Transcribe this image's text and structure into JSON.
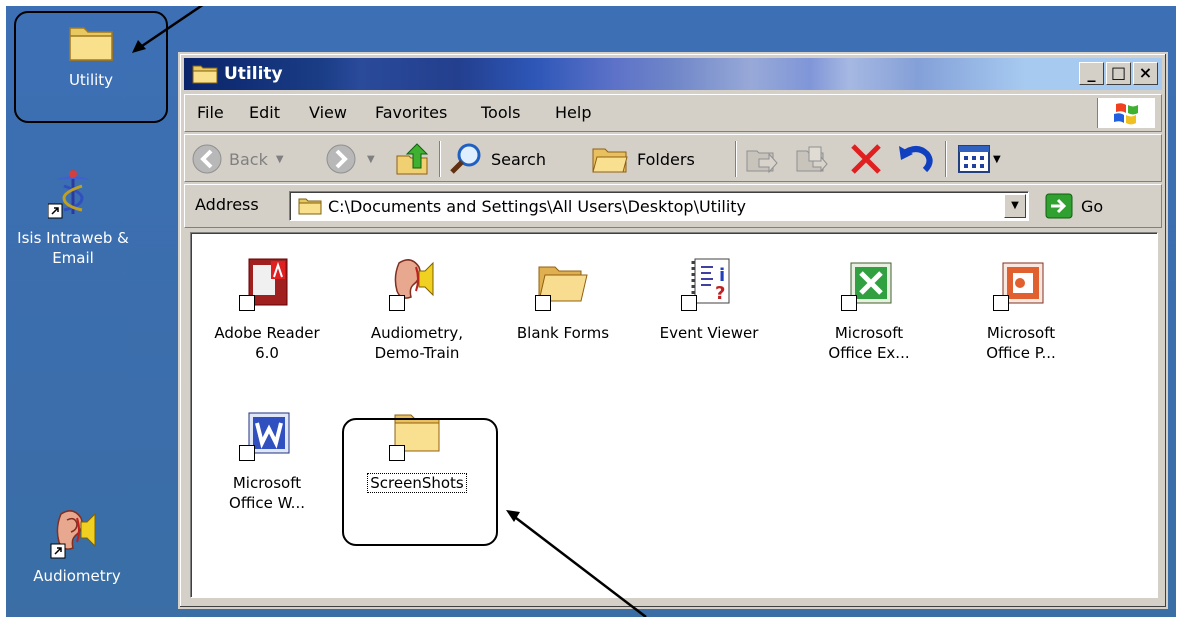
{
  "desktop": {
    "icons": [
      {
        "label": "Utility",
        "icon": "folder-icon"
      },
      {
        "label": "Isis Intraweb & Email",
        "icon": "caduceus-icon"
      },
      {
        "label": "Audiometry",
        "icon": "ear-speaker-icon"
      }
    ]
  },
  "window": {
    "title": "Utility",
    "controls": {
      "minimize": "_",
      "maximize": "□",
      "close": "×"
    },
    "menu": [
      {
        "label": "File"
      },
      {
        "label": "Edit"
      },
      {
        "label": "View"
      },
      {
        "label": "Favorites"
      },
      {
        "label": "Tools"
      },
      {
        "label": "Help"
      }
    ],
    "toolbar": {
      "back": "Back",
      "search": "Search",
      "folders": "Folders"
    },
    "address": {
      "label": "Address",
      "value": "C:\\Documents and Settings\\All Users\\Desktop\\Utility",
      "go": "Go"
    },
    "items": [
      {
        "label1": "Adobe Reader",
        "label2": "6.0",
        "icon": "adobe-reader-icon"
      },
      {
        "label1": "Audiometry,",
        "label2": "Demo-Train",
        "icon": "ear-speaker-icon"
      },
      {
        "label1": "Blank Forms",
        "label2": "",
        "icon": "open-folder-icon"
      },
      {
        "label1": "Event Viewer",
        "label2": "",
        "icon": "event-viewer-icon"
      },
      {
        "label1": "Microsoft",
        "label2": "Office Ex...",
        "icon": "excel-icon"
      },
      {
        "label1": "Microsoft",
        "label2": "Office P...",
        "icon": "powerpoint-icon"
      },
      {
        "label1": "Microsoft",
        "label2": "Office W...",
        "icon": "word-icon"
      },
      {
        "label1": "ScreenShots",
        "label2": "",
        "icon": "folder-icon"
      }
    ]
  },
  "colors": {
    "desktop": "#3a6ea5",
    "window_face": "#d4d0c8",
    "title_active": "#0a246a"
  }
}
